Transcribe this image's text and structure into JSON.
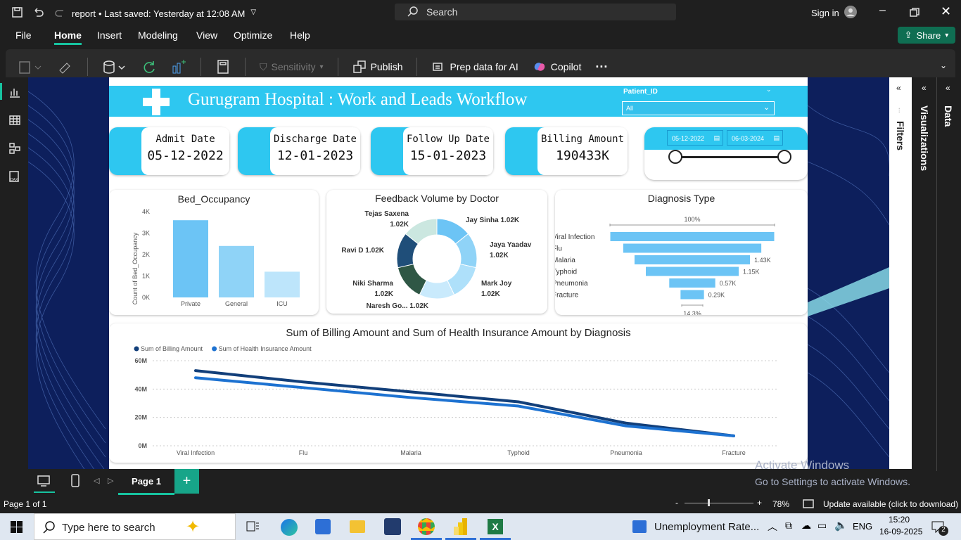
{
  "titlebar": {
    "doc_title": "report",
    "save_status": "• Last saved: Yesterday at 12:08 AM",
    "search_placeholder": "Search",
    "signin": "Sign in"
  },
  "menu": {
    "items": [
      "File",
      "Home",
      "Insert",
      "Modeling",
      "View",
      "Optimize",
      "Help"
    ],
    "share": "Share"
  },
  "ribbon": {
    "sensitivity": "Sensitivity",
    "publish": "Publish",
    "prep": "Prep data for AI",
    "copilot": "Copilot",
    "more": "···"
  },
  "report": {
    "title": "Gurugram Hospital : Work and Leads Workflow",
    "patient_filter": {
      "label": "Patient_ID",
      "value": "All"
    },
    "kpis": [
      {
        "label": "Admit Date",
        "value": "05-12-2022"
      },
      {
        "label": "Discharge Date",
        "value": "12-01-2023"
      },
      {
        "label": "Follow Up Date",
        "value": "15-01-2023"
      },
      {
        "label": "Billing Amount",
        "value": "190433K"
      }
    ],
    "date_slicer": {
      "start": "05-12-2022",
      "end": "06-03-2024"
    }
  },
  "chart_data": [
    {
      "type": "bar",
      "title": "Bed_Occupancy",
      "ylabel": "Count of Bed_Occupancy",
      "categories": [
        "Private",
        "General",
        "ICU"
      ],
      "values": [
        3600,
        2400,
        1200
      ],
      "ylim": [
        0,
        4000
      ],
      "yticks": [
        "0K",
        "1K",
        "2K",
        "3K",
        "4K"
      ],
      "colors": [
        "#6cc4f5",
        "#8fd3f7",
        "#bde5fb"
      ]
    },
    {
      "type": "pie",
      "title": "Feedback Volume by Doctor",
      "slices": [
        {
          "name": "Jay Sinha",
          "value": "1.02K",
          "color": "#6cc4f5"
        },
        {
          "name": "Jaya Yaadav",
          "value": "1.02K",
          "color": "#8fd3f7"
        },
        {
          "name": "Mark Joy",
          "value": "1.02K",
          "color": "#aee0fa"
        },
        {
          "name": "Naresh Go...",
          "value": "1.02K",
          "color": "#c9eafc"
        },
        {
          "name": "Niki Sharma",
          "value": "1.02K",
          "color": "#2f5745"
        },
        {
          "name": "Ravi D",
          "value": "1.02K",
          "color": "#1f4e79"
        },
        {
          "name": "Tejas Saxena",
          "value": "1.02K",
          "color": "#cbe7e0"
        }
      ]
    },
    {
      "type": "bar",
      "title": "Diagnosis Type",
      "orientation": "funnel",
      "top_label": "100%",
      "bottom_label": "14.3%",
      "categories": [
        "Viral Infection",
        "Flu",
        "Malaria",
        "Typhoid",
        "Pneumonia",
        "Fracture"
      ],
      "values": [
        2.03,
        1.71,
        1.43,
        1.15,
        0.57,
        0.29
      ],
      "data_labels": [
        "",
        "",
        "1.43K",
        "1.15K",
        "0.57K",
        "0.29K"
      ],
      "color": "#6cc4f5"
    },
    {
      "type": "line",
      "title": "Sum of Billing Amount and Sum of Health Insurance Amount by Diagnosis",
      "categories": [
        "Viral Infection",
        "Flu",
        "Malaria",
        "Typhoid",
        "Pneumonia",
        "Fracture"
      ],
      "ylim": [
        0,
        60
      ],
      "yticks": [
        "0M",
        "20M",
        "40M",
        "60M"
      ],
      "series": [
        {
          "name": "Sum of Billing Amount",
          "values": [
            53,
            45,
            38,
            31,
            16,
            7
          ],
          "color": "#123f7a"
        },
        {
          "name": "Sum of Health Insurance Amount",
          "values": [
            48,
            41,
            34,
            28,
            14,
            7
          ],
          "color": "#1d72d1"
        }
      ]
    }
  ],
  "watermark": {
    "line1": "Activate Windows",
    "line2": "Go to Settings to activate Windows."
  },
  "pagebar": {
    "page": "Page 1"
  },
  "statusbar": {
    "pages": "Page 1 of 1",
    "zoom": "78%",
    "update": "Update available (click to download)"
  },
  "panes": {
    "filters": "Filters",
    "visualizations": "Visualizations",
    "data": "Data"
  },
  "taskbar": {
    "search": "Type here to search",
    "window": "Unemployment Rate...",
    "lang": "ENG",
    "time": "15:20",
    "date": "16-09-2025",
    "notif": "2"
  }
}
